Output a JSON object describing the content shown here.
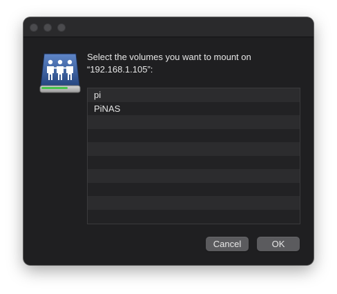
{
  "dialog": {
    "prompt_line1": "Select the volumes you want to mount on",
    "prompt_line2": "“192.168.1.105”:",
    "icon": "shared-network-drive-icon"
  },
  "volumes": [
    "pi",
    "PiNAS",
    "",
    "",
    "",
    "",
    "",
    "",
    "",
    ""
  ],
  "buttons": {
    "cancel_label": "Cancel",
    "ok_label": "OK"
  },
  "colors": {
    "window_bg": "#1f1f21",
    "list_row_alt": "#2c2c2e",
    "button_bg": "#5b5b5e",
    "icon_blue": "#2f4f86"
  }
}
